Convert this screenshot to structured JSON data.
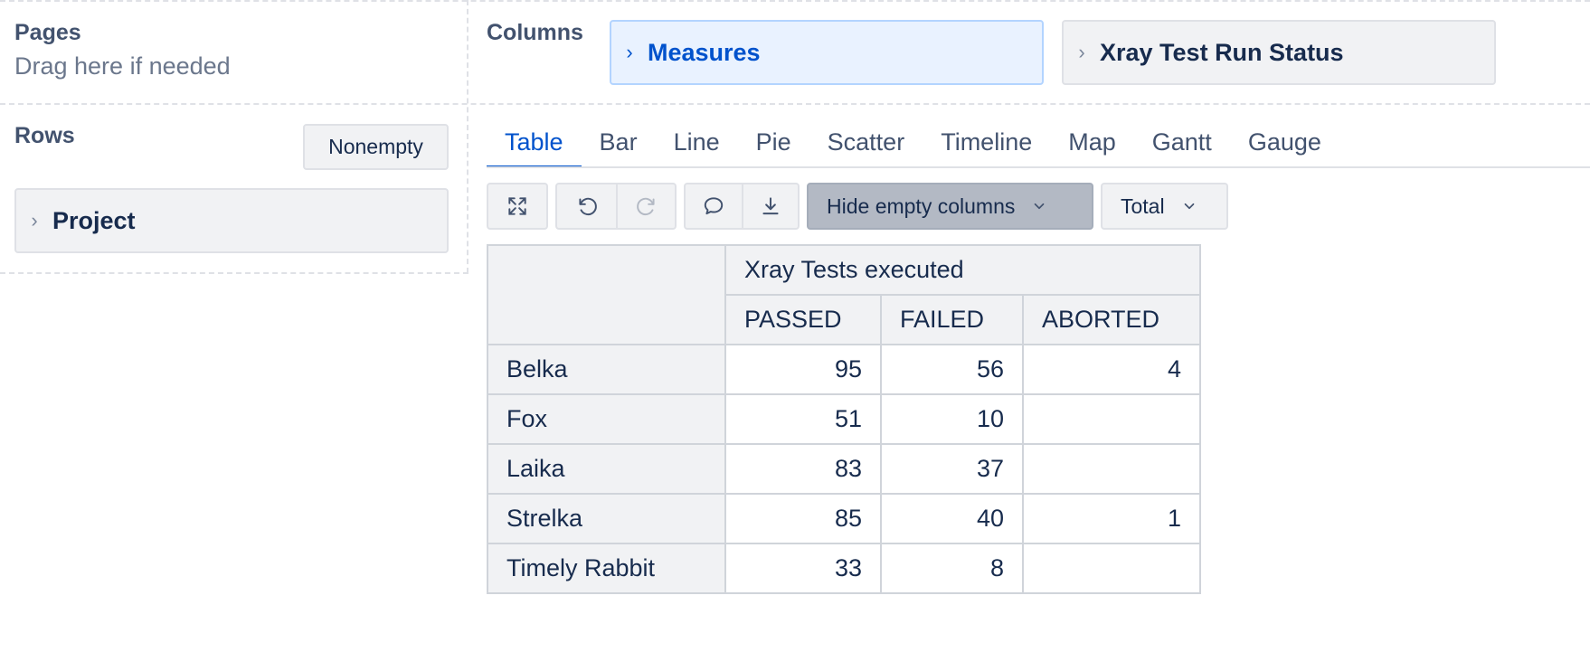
{
  "pages": {
    "title": "Pages",
    "hint": "Drag here if needed"
  },
  "columns": {
    "title": "Columns",
    "chips": [
      {
        "label": "Measures",
        "active": true
      },
      {
        "label": "Xray Test Run Status",
        "active": false
      }
    ]
  },
  "rows": {
    "title": "Rows",
    "nonempty_label": "Nonempty",
    "chips": [
      {
        "label": "Project"
      }
    ]
  },
  "tabs": [
    "Table",
    "Bar",
    "Line",
    "Pie",
    "Scatter",
    "Timeline",
    "Map",
    "Gantt",
    "Gauge"
  ],
  "active_tab": "Table",
  "toolbar": {
    "icons": [
      "fullscreen-icon",
      "undo-icon",
      "redo-icon",
      "comment-icon",
      "download-icon"
    ],
    "hide_empty_label": "Hide empty columns",
    "total_label": "Total"
  },
  "table": {
    "measure_header": "Xray Tests executed",
    "columns": [
      "PASSED",
      "FAILED",
      "ABORTED"
    ],
    "rows": [
      {
        "label": "Belka",
        "values": [
          "95",
          "56",
          "4"
        ]
      },
      {
        "label": "Fox",
        "values": [
          "51",
          "10",
          ""
        ]
      },
      {
        "label": "Laika",
        "values": [
          "83",
          "37",
          ""
        ]
      },
      {
        "label": "Strelka",
        "values": [
          "85",
          "40",
          "1"
        ]
      },
      {
        "label": "Timely Rabbit",
        "values": [
          "33",
          "8",
          ""
        ]
      }
    ]
  },
  "colors": {
    "accent": "#0052cc",
    "chip_active_bg": "#e9f2ff",
    "panel_bg": "#f1f2f4",
    "border": "#dfe1e6"
  }
}
